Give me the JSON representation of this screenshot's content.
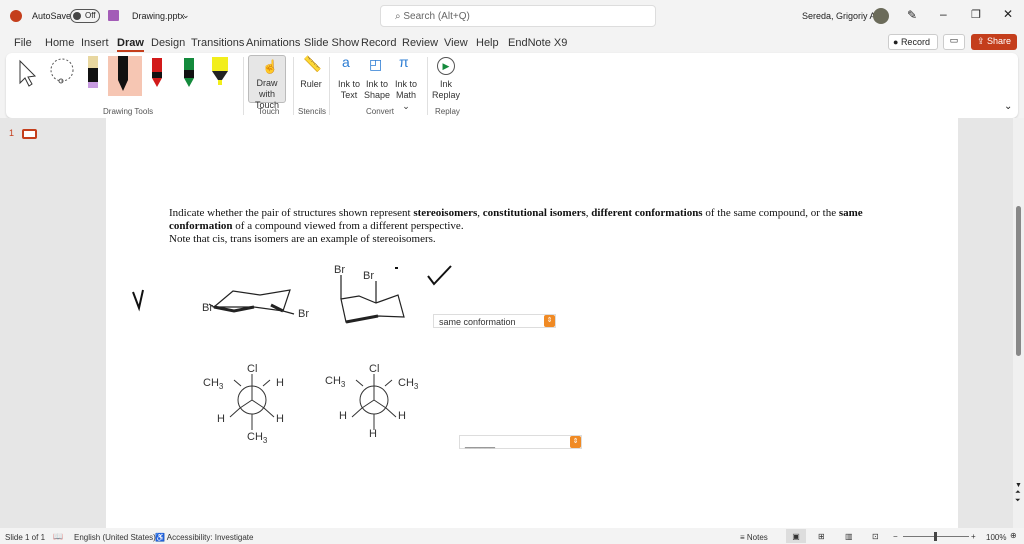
{
  "titlebar": {
    "autosave": "AutoSave",
    "toggle": "Off",
    "filename": "Drawing.pptx",
    "search_placeholder": "Search (Alt+Q)",
    "user": "Sereda, Grigoriy A"
  },
  "tabs": [
    "File",
    "Home",
    "Insert",
    "Draw",
    "Design",
    "Transitions",
    "Animations",
    "Slide Show",
    "Record",
    "Review",
    "View",
    "Help",
    "EndNote X9"
  ],
  "actions": {
    "record": "Record",
    "share": "Share"
  },
  "ribbon": {
    "draw_touch": "Draw with Touch",
    "ruler": "Ruler",
    "ink_text": "Ink to Text",
    "ink_shape": "Ink to Shape",
    "ink_math": "Ink to Math",
    "ink_replay": "Ink Replay",
    "groups": {
      "drawing": "Drawing Tools",
      "touch": "Touch",
      "stencils": "Stencils",
      "convert": "Convert",
      "replay": "Replay"
    }
  },
  "thumbs": {
    "number": "1"
  },
  "slide": {
    "q1": "Indicate whether the pair of structures shown represent ",
    "b1": "stereoisomers",
    "c1": ", ",
    "b2": "constitutional isomers",
    "c2": ", ",
    "b3": "different conformations",
    "q2": " of the same compound, or the ",
    "b4": "same conformation",
    "q3": " of a compound viewed from a different perspective.",
    "note": "Note that cis, trans isomers are an example of stereoisomers.",
    "dropdown1": "same conformation",
    "dropdown2": "______",
    "labels": {
      "br": "Br",
      "cl": "Cl",
      "ch3": "CH",
      "sub3": "3",
      "h": "H"
    }
  },
  "status": {
    "slide": "Slide 1 of 1",
    "lang": "English (United States)",
    "access": "Accessibility: Investigate",
    "notes": "Notes",
    "zoom": "100%"
  }
}
